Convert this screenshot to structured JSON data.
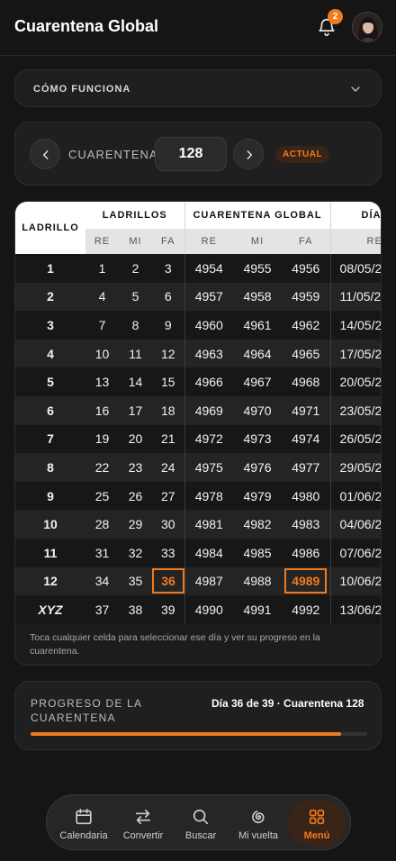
{
  "header": {
    "title": "Cuarentena Global",
    "notification_count": "2"
  },
  "how_it_works": {
    "label": "CÓMO FUNCIONA"
  },
  "quarantine_selector": {
    "label": "CUARENTENA",
    "value": "128",
    "badge": "ACTUAL"
  },
  "table": {
    "header_ladrillo": "LADRILLO",
    "group_ladrillos": "LADRILLOS",
    "group_global": "CUARENTENA GLOBAL",
    "group_dia": "DÍA",
    "sub_re": "RE",
    "sub_mi": "MI",
    "sub_fa": "FA",
    "sub_date": "RE",
    "rows": [
      {
        "label": "1",
        "re": "1",
        "mi": "2",
        "fa": "3",
        "g_re": "4954",
        "g_mi": "4955",
        "g_fa": "4956",
        "date": "08/05/2"
      },
      {
        "label": "2",
        "re": "4",
        "mi": "5",
        "fa": "6",
        "g_re": "4957",
        "g_mi": "4958",
        "g_fa": "4959",
        "date": "11/05/2"
      },
      {
        "label": "3",
        "re": "7",
        "mi": "8",
        "fa": "9",
        "g_re": "4960",
        "g_mi": "4961",
        "g_fa": "4962",
        "date": "14/05/2"
      },
      {
        "label": "4",
        "re": "10",
        "mi": "11",
        "fa": "12",
        "g_re": "4963",
        "g_mi": "4964",
        "g_fa": "4965",
        "date": "17/05/2"
      },
      {
        "label": "5",
        "re": "13",
        "mi": "14",
        "fa": "15",
        "g_re": "4966",
        "g_mi": "4967",
        "g_fa": "4968",
        "date": "20/05/2"
      },
      {
        "label": "6",
        "re": "16",
        "mi": "17",
        "fa": "18",
        "g_re": "4969",
        "g_mi": "4970",
        "g_fa": "4971",
        "date": "23/05/2"
      },
      {
        "label": "7",
        "re": "19",
        "mi": "20",
        "fa": "21",
        "g_re": "4972",
        "g_mi": "4973",
        "g_fa": "4974",
        "date": "26/05/2"
      },
      {
        "label": "8",
        "re": "22",
        "mi": "23",
        "fa": "24",
        "g_re": "4975",
        "g_mi": "4976",
        "g_fa": "4977",
        "date": "29/05/2"
      },
      {
        "label": "9",
        "re": "25",
        "mi": "26",
        "fa": "27",
        "g_re": "4978",
        "g_mi": "4979",
        "g_fa": "4980",
        "date": "01/06/2"
      },
      {
        "label": "10",
        "re": "28",
        "mi": "29",
        "fa": "30",
        "g_re": "4981",
        "g_mi": "4982",
        "g_fa": "4983",
        "date": "04/06/2"
      },
      {
        "label": "11",
        "re": "31",
        "mi": "32",
        "fa": "33",
        "g_re": "4984",
        "g_mi": "4985",
        "g_fa": "4986",
        "date": "07/06/2"
      },
      {
        "label": "12",
        "re": "34",
        "mi": "35",
        "fa": "36",
        "g_re": "4987",
        "g_mi": "4988",
        "g_fa": "4989",
        "date": "10/06/2",
        "highlight": [
          "fa",
          "g_fa"
        ]
      },
      {
        "label": "XYZ",
        "re": "37",
        "mi": "38",
        "fa": "39",
        "g_re": "4990",
        "g_mi": "4991",
        "g_fa": "4992",
        "date": "13/06/2",
        "italic": true
      }
    ],
    "hint": "Toca cualquier celda para seleccionar ese día y ver su progreso en la cuarentena."
  },
  "progress": {
    "label": "PROGRESO DE LA CUARENTENA",
    "value_text": "Día 36 de 39 · Cuarentena 128",
    "fraction": 0.923
  },
  "bottom_nav": {
    "items": [
      {
        "label": "Calendaria",
        "icon": "calendar-icon"
      },
      {
        "label": "Convertir",
        "icon": "swap-arrows-icon"
      },
      {
        "label": "Buscar",
        "icon": "search-icon"
      },
      {
        "label": "Mi vuelta",
        "icon": "spiral-icon"
      },
      {
        "label": "Menú",
        "icon": "grid-icon",
        "active": true
      }
    ]
  },
  "colors": {
    "accent": "#f07a1f",
    "background": "#151515",
    "card": "#1f1f1f"
  }
}
